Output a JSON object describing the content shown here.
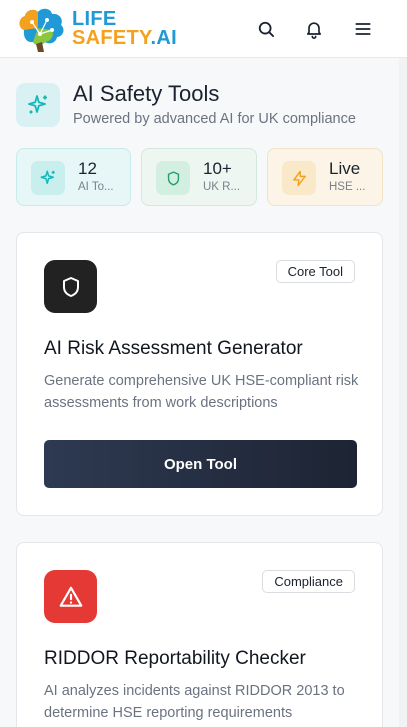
{
  "header": {
    "logo": {
      "line1": "LIFE",
      "line2a": "SAFETY",
      "line2b": ".AI"
    },
    "icons": [
      "search-icon",
      "bell-icon",
      "menu-icon"
    ]
  },
  "page": {
    "title": "AI Safety Tools",
    "subtitle": "Powered by advanced AI for UK compliance",
    "icon": "sparkles-icon"
  },
  "stats": [
    {
      "value": "12",
      "label": "AI To...",
      "icon": "sparkles-icon",
      "accent": "#14b8b8"
    },
    {
      "value": "10+",
      "label": "UK R...",
      "icon": "shield-icon",
      "accent": "#22a06b"
    },
    {
      "value": "Live",
      "label": "HSE ...",
      "icon": "lightning-icon",
      "accent": "#f0a21a"
    }
  ],
  "tools": [
    {
      "badge": "Core Tool",
      "title": "AI Risk Assessment Generator",
      "description": "Generate comprehensive UK HSE-compliant risk assessments from work descriptions",
      "button": "Open Tool",
      "icon": "shield-icon",
      "color": "#222222"
    },
    {
      "badge": "Compliance",
      "title": "RIDDOR Reportability Checker",
      "description": "AI analyzes incidents against RIDDOR 2013 to determine HSE reporting requirements",
      "icon": "warning-icon",
      "color": "#e53935"
    }
  ]
}
